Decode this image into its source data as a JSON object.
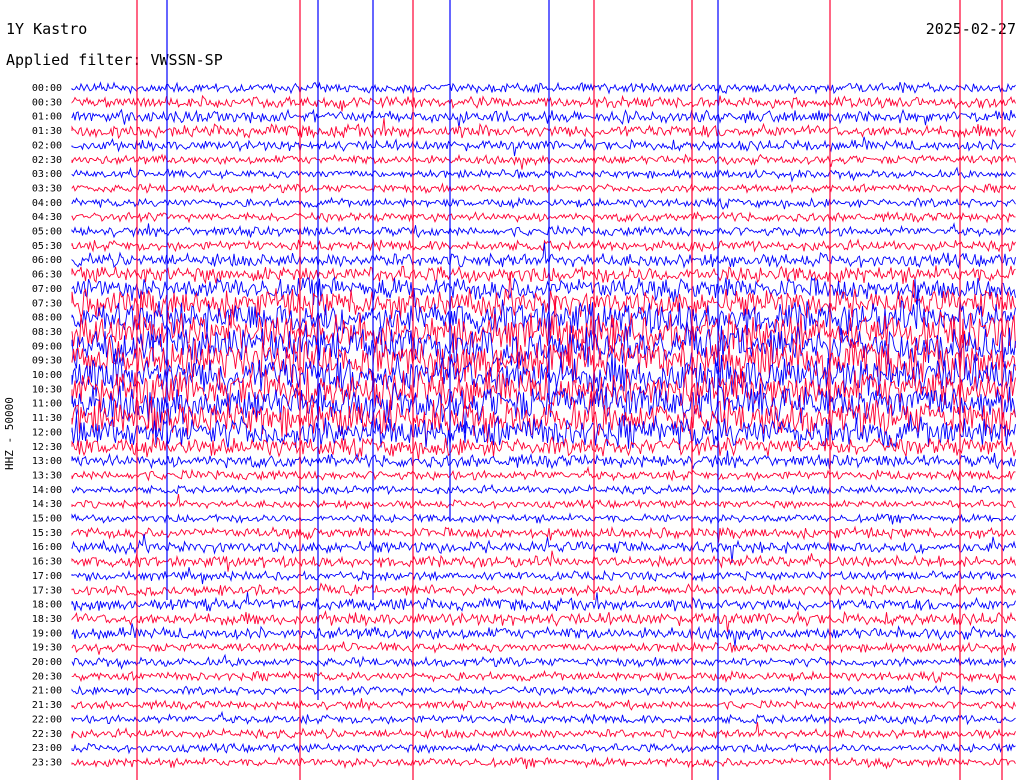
{
  "header": {
    "station": "1Y Kastro",
    "date": "2025-02-27",
    "filter_label": "Applied filter: VWSSN-SP"
  },
  "chart_data": {
    "type": "line",
    "title": "1Y Kastro",
    "subtitle": "Applied filter: VWSSN-SP",
    "ylabel": "HHZ - 50000",
    "row_labels": [
      "00:00",
      "00:30",
      "01:00",
      "01:30",
      "02:00",
      "02:30",
      "03:00",
      "03:30",
      "04:00",
      "04:30",
      "05:00",
      "05:30",
      "06:00",
      "06:30",
      "07:00",
      "07:30",
      "08:00",
      "08:30",
      "09:00",
      "09:30",
      "10:00",
      "10:30",
      "11:00",
      "11:30",
      "12:00",
      "12:30",
      "13:00",
      "13:30",
      "14:00",
      "14:30",
      "15:00",
      "15:30",
      "16:00",
      "16:30",
      "17:00",
      "17:30",
      "18:00",
      "18:30",
      "19:00",
      "19:30",
      "20:00",
      "20:30",
      "21:00",
      "21:30",
      "22:00",
      "22:30",
      "23:00",
      "23:30"
    ],
    "trace_colors": [
      "#0000ff",
      "#ff0033"
    ],
    "activity_levels": [
      0.12,
      0.15,
      0.18,
      0.2,
      0.14,
      0.1,
      0.08,
      0.08,
      0.09,
      0.1,
      0.12,
      0.14,
      0.22,
      0.3,
      0.45,
      0.6,
      0.75,
      0.85,
      0.9,
      0.95,
      0.9,
      0.88,
      0.85,
      0.8,
      0.7,
      0.35,
      0.2,
      0.12,
      0.08,
      0.07,
      0.08,
      0.14,
      0.18,
      0.16,
      0.1,
      0.14,
      0.18,
      0.2,
      0.18,
      0.1,
      0.1,
      0.1,
      0.08,
      0.08,
      0.1,
      0.1,
      0.09,
      0.1
    ],
    "grid": false
  }
}
